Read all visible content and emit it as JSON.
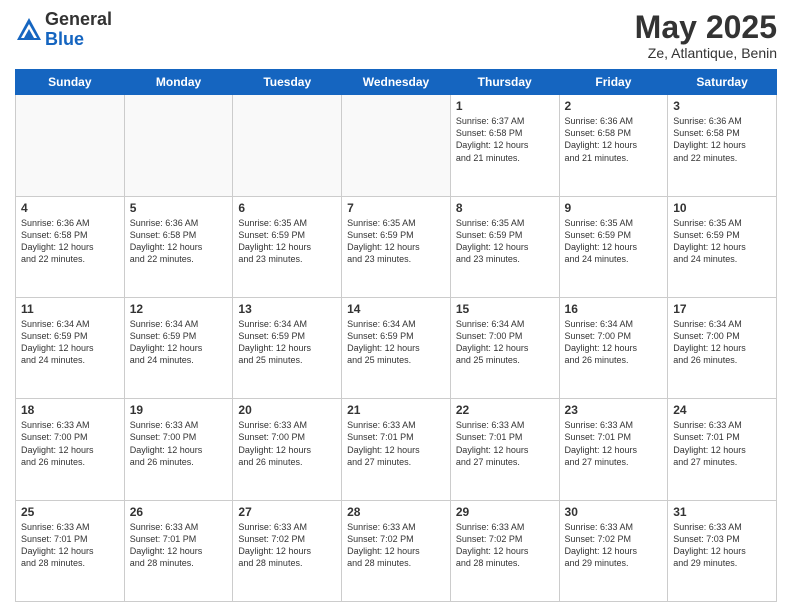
{
  "header": {
    "logo_line1": "General",
    "logo_line2": "Blue",
    "month": "May 2025",
    "location": "Ze, Atlantique, Benin"
  },
  "days_of_week": [
    "Sunday",
    "Monday",
    "Tuesday",
    "Wednesday",
    "Thursday",
    "Friday",
    "Saturday"
  ],
  "weeks": [
    [
      {
        "day": "",
        "info": ""
      },
      {
        "day": "",
        "info": ""
      },
      {
        "day": "",
        "info": ""
      },
      {
        "day": "",
        "info": ""
      },
      {
        "day": "1",
        "info": "Sunrise: 6:37 AM\nSunset: 6:58 PM\nDaylight: 12 hours\nand 21 minutes."
      },
      {
        "day": "2",
        "info": "Sunrise: 6:36 AM\nSunset: 6:58 PM\nDaylight: 12 hours\nand 21 minutes."
      },
      {
        "day": "3",
        "info": "Sunrise: 6:36 AM\nSunset: 6:58 PM\nDaylight: 12 hours\nand 22 minutes."
      }
    ],
    [
      {
        "day": "4",
        "info": "Sunrise: 6:36 AM\nSunset: 6:58 PM\nDaylight: 12 hours\nand 22 minutes."
      },
      {
        "day": "5",
        "info": "Sunrise: 6:36 AM\nSunset: 6:58 PM\nDaylight: 12 hours\nand 22 minutes."
      },
      {
        "day": "6",
        "info": "Sunrise: 6:35 AM\nSunset: 6:59 PM\nDaylight: 12 hours\nand 23 minutes."
      },
      {
        "day": "7",
        "info": "Sunrise: 6:35 AM\nSunset: 6:59 PM\nDaylight: 12 hours\nand 23 minutes."
      },
      {
        "day": "8",
        "info": "Sunrise: 6:35 AM\nSunset: 6:59 PM\nDaylight: 12 hours\nand 23 minutes."
      },
      {
        "day": "9",
        "info": "Sunrise: 6:35 AM\nSunset: 6:59 PM\nDaylight: 12 hours\nand 24 minutes."
      },
      {
        "day": "10",
        "info": "Sunrise: 6:35 AM\nSunset: 6:59 PM\nDaylight: 12 hours\nand 24 minutes."
      }
    ],
    [
      {
        "day": "11",
        "info": "Sunrise: 6:34 AM\nSunset: 6:59 PM\nDaylight: 12 hours\nand 24 minutes."
      },
      {
        "day": "12",
        "info": "Sunrise: 6:34 AM\nSunset: 6:59 PM\nDaylight: 12 hours\nand 24 minutes."
      },
      {
        "day": "13",
        "info": "Sunrise: 6:34 AM\nSunset: 6:59 PM\nDaylight: 12 hours\nand 25 minutes."
      },
      {
        "day": "14",
        "info": "Sunrise: 6:34 AM\nSunset: 6:59 PM\nDaylight: 12 hours\nand 25 minutes."
      },
      {
        "day": "15",
        "info": "Sunrise: 6:34 AM\nSunset: 7:00 PM\nDaylight: 12 hours\nand 25 minutes."
      },
      {
        "day": "16",
        "info": "Sunrise: 6:34 AM\nSunset: 7:00 PM\nDaylight: 12 hours\nand 26 minutes."
      },
      {
        "day": "17",
        "info": "Sunrise: 6:34 AM\nSunset: 7:00 PM\nDaylight: 12 hours\nand 26 minutes."
      }
    ],
    [
      {
        "day": "18",
        "info": "Sunrise: 6:33 AM\nSunset: 7:00 PM\nDaylight: 12 hours\nand 26 minutes."
      },
      {
        "day": "19",
        "info": "Sunrise: 6:33 AM\nSunset: 7:00 PM\nDaylight: 12 hours\nand 26 minutes."
      },
      {
        "day": "20",
        "info": "Sunrise: 6:33 AM\nSunset: 7:00 PM\nDaylight: 12 hours\nand 26 minutes."
      },
      {
        "day": "21",
        "info": "Sunrise: 6:33 AM\nSunset: 7:01 PM\nDaylight: 12 hours\nand 27 minutes."
      },
      {
        "day": "22",
        "info": "Sunrise: 6:33 AM\nSunset: 7:01 PM\nDaylight: 12 hours\nand 27 minutes."
      },
      {
        "day": "23",
        "info": "Sunrise: 6:33 AM\nSunset: 7:01 PM\nDaylight: 12 hours\nand 27 minutes."
      },
      {
        "day": "24",
        "info": "Sunrise: 6:33 AM\nSunset: 7:01 PM\nDaylight: 12 hours\nand 27 minutes."
      }
    ],
    [
      {
        "day": "25",
        "info": "Sunrise: 6:33 AM\nSunset: 7:01 PM\nDaylight: 12 hours\nand 28 minutes."
      },
      {
        "day": "26",
        "info": "Sunrise: 6:33 AM\nSunset: 7:01 PM\nDaylight: 12 hours\nand 28 minutes."
      },
      {
        "day": "27",
        "info": "Sunrise: 6:33 AM\nSunset: 7:02 PM\nDaylight: 12 hours\nand 28 minutes."
      },
      {
        "day": "28",
        "info": "Sunrise: 6:33 AM\nSunset: 7:02 PM\nDaylight: 12 hours\nand 28 minutes."
      },
      {
        "day": "29",
        "info": "Sunrise: 6:33 AM\nSunset: 7:02 PM\nDaylight: 12 hours\nand 28 minutes."
      },
      {
        "day": "30",
        "info": "Sunrise: 6:33 AM\nSunset: 7:02 PM\nDaylight: 12 hours\nand 29 minutes."
      },
      {
        "day": "31",
        "info": "Sunrise: 6:33 AM\nSunset: 7:03 PM\nDaylight: 12 hours\nand 29 minutes."
      }
    ]
  ]
}
